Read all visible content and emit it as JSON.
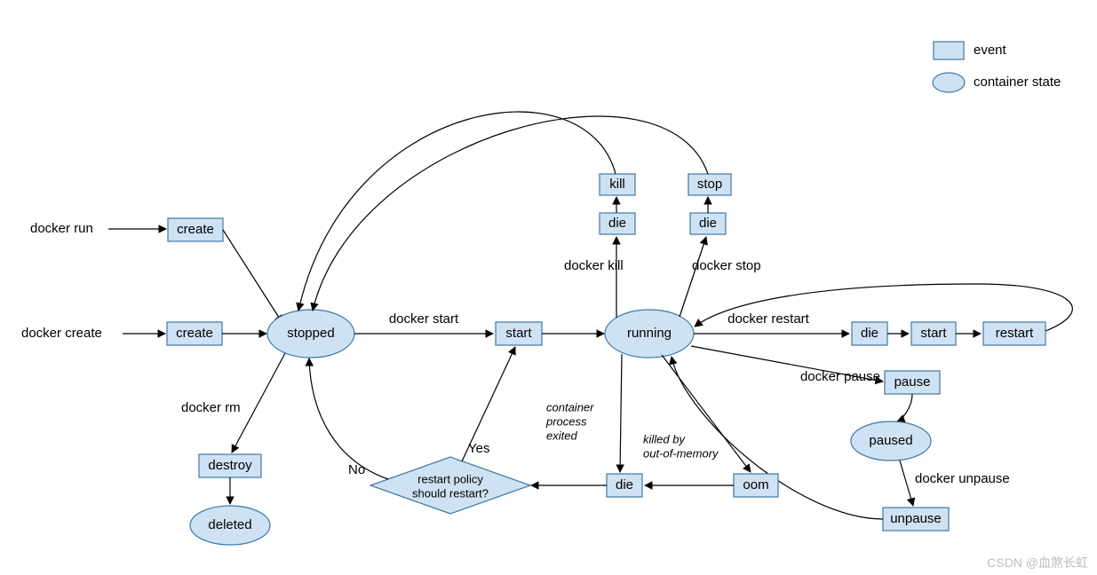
{
  "legend": {
    "event": "event",
    "state": "container state"
  },
  "commands": {
    "run": "docker run",
    "create": "docker create",
    "start": "docker start",
    "kill": "docker kill",
    "stop": "docker stop",
    "restart": "docker restart",
    "pause": "docker pause",
    "unpause": "docker unpause",
    "rm": "docker rm"
  },
  "events": {
    "create": "create",
    "start": "start",
    "kill": "kill",
    "stop": "stop",
    "die": "die",
    "oom": "oom",
    "restart": "restart",
    "pause": "pause",
    "unpause": "unpause",
    "destroy": "destroy"
  },
  "states": {
    "stopped": "stopped",
    "running": "running",
    "paused": "paused",
    "deleted": "deleted"
  },
  "decision": {
    "question_l1": "restart policy",
    "question_l2": "should restart?",
    "yes": "Yes",
    "no": "No"
  },
  "notes": {
    "exited_l1": "container",
    "exited_l2": "process",
    "exited_l3": "exited",
    "oom_l1": "killed by",
    "oom_l2": "out-of-memory"
  },
  "watermark": "CSDN @血煞长虹"
}
